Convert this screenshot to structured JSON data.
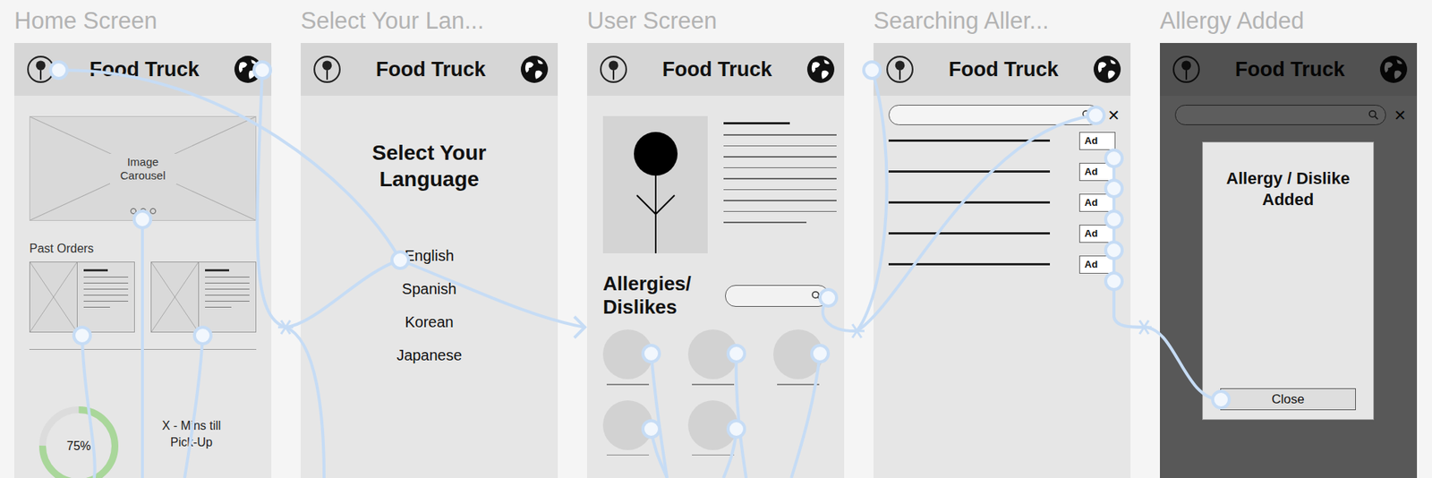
{
  "app_header": {
    "title": "Food Truck"
  },
  "home": {
    "label": "Home Screen",
    "carousel": "Image Carousel",
    "past_orders": "Past Orders",
    "orders": [
      {},
      {}
    ],
    "progress": {
      "reading": "75%",
      "level": 0.75
    },
    "pickup": "X - Mins till Pick-Up"
  },
  "language": {
    "label": "Select Your Lan...",
    "heading": "Select Your Language",
    "options": [
      {
        "label": "English"
      },
      {
        "label": "Spanish"
      },
      {
        "label": "Korean"
      },
      {
        "label": "Japanese"
      }
    ]
  },
  "user": {
    "label": "User Screen",
    "section": "Allergies/ Dislikes",
    "items": [
      {},
      {},
      {},
      {},
      {}
    ]
  },
  "search": {
    "label": "Searching Aller...",
    "close": "✕",
    "results": [
      {
        "button": "Ad"
      },
      {
        "button": "Ad"
      },
      {
        "button": "Ad"
      },
      {
        "button": "Ad"
      },
      {
        "button": "Ad"
      }
    ]
  },
  "added": {
    "label": "Allergy Added",
    "close_icon": "✕",
    "title": "Allergy / Dislike Added",
    "button": "Close"
  }
}
